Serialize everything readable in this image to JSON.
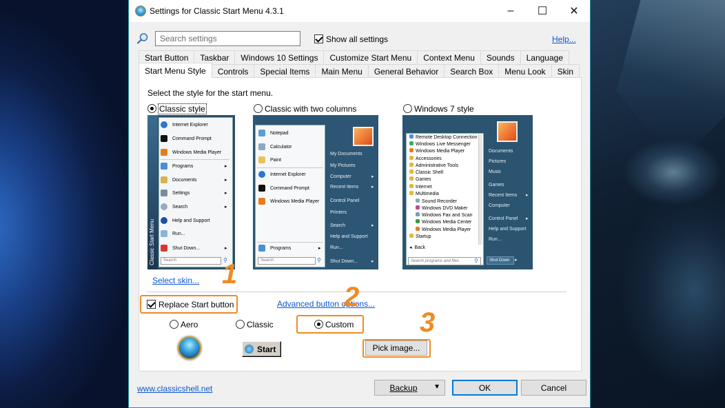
{
  "window": {
    "title": "Settings for Classic Start Menu 4.3.1",
    "minimize_glyph": "–",
    "maximize_glyph": "☐",
    "close_glyph": "✕"
  },
  "toolbar": {
    "search_placeholder": "Search settings",
    "show_all_label": "Show all settings",
    "show_all_checked": true,
    "help_link": "Help..."
  },
  "tabs": {
    "row1": [
      "Start Button",
      "Taskbar",
      "Windows 10 Settings",
      "Customize Start Menu",
      "Context Menu",
      "Sounds",
      "Language"
    ],
    "row2": [
      "Start Menu Style",
      "Controls",
      "Special Items",
      "Main Menu",
      "General Behavior",
      "Search Box",
      "Menu Look",
      "Skin"
    ],
    "active": "Start Menu Style"
  },
  "style_section": {
    "prompt": "Select the style for the start menu.",
    "options": [
      {
        "label": "Classic style",
        "selected": true
      },
      {
        "label": "Classic with two columns",
        "selected": false
      },
      {
        "label": "Windows 7 style",
        "selected": false
      }
    ],
    "select_skin_link": "Select skin..."
  },
  "preview_classic": {
    "sidebar_text": "Classic Start Menu",
    "items": [
      "Internet Explorer",
      "Command Prompt",
      "Windows Media Player",
      "Programs",
      "Documents",
      "Settings",
      "Search",
      "Help and Support",
      "Run...",
      "Shut Down..."
    ],
    "search": "Search"
  },
  "preview_two_columns": {
    "left_items": [
      "Notepad",
      "Calculator",
      "Paint",
      "Internet Explorer",
      "Command Prompt",
      "Windows Media Player"
    ],
    "programs": "Programs",
    "search": "Search",
    "right_items": [
      "My Documents",
      "My Pictures",
      "Computer",
      "Recent Items",
      "Control Panel",
      "Printers",
      "Search",
      "Help and Support",
      "Run...",
      "Shut Down..."
    ]
  },
  "preview_win7": {
    "left_items": [
      "Remote Desktop Connection",
      "Windows Live Messenger",
      "Windows Media Player",
      "Accessories",
      "Administrative Tools",
      "Classic Shell",
      "Games",
      "Internet",
      "Multimedia",
      "Sound Recorder",
      "Windows DVD Maker",
      "Windows Fax and Scan",
      "Windows Media Center",
      "Windows Media Player",
      "Startup",
      "Back"
    ],
    "search": "Search programs and files",
    "right_items": [
      "Documents",
      "Pictures",
      "Music",
      "Games",
      "Recent Items",
      "Computer",
      "Control Panel",
      "Help and Support",
      "Run...",
      "Shut Down"
    ]
  },
  "button_section": {
    "replace_start_label": "Replace Start button",
    "replace_start_checked": true,
    "advanced_link": "Advanced button options...",
    "options": [
      {
        "label": "Aero",
        "selected": false
      },
      {
        "label": "Classic",
        "selected": false
      },
      {
        "label": "Custom",
        "selected": true
      }
    ],
    "classic_button_text": "Start",
    "pick_image_label": "Pick image..."
  },
  "annotations": [
    "1",
    "2",
    "3"
  ],
  "footer": {
    "website_link": "www.classicshell.net",
    "backup_label": "Backup",
    "ok_label": "OK",
    "cancel_label": "Cancel"
  },
  "colors": {
    "accent_orange": "#f08a24",
    "link_blue": "#0b57d0",
    "win7_panel": "#2a5470"
  }
}
